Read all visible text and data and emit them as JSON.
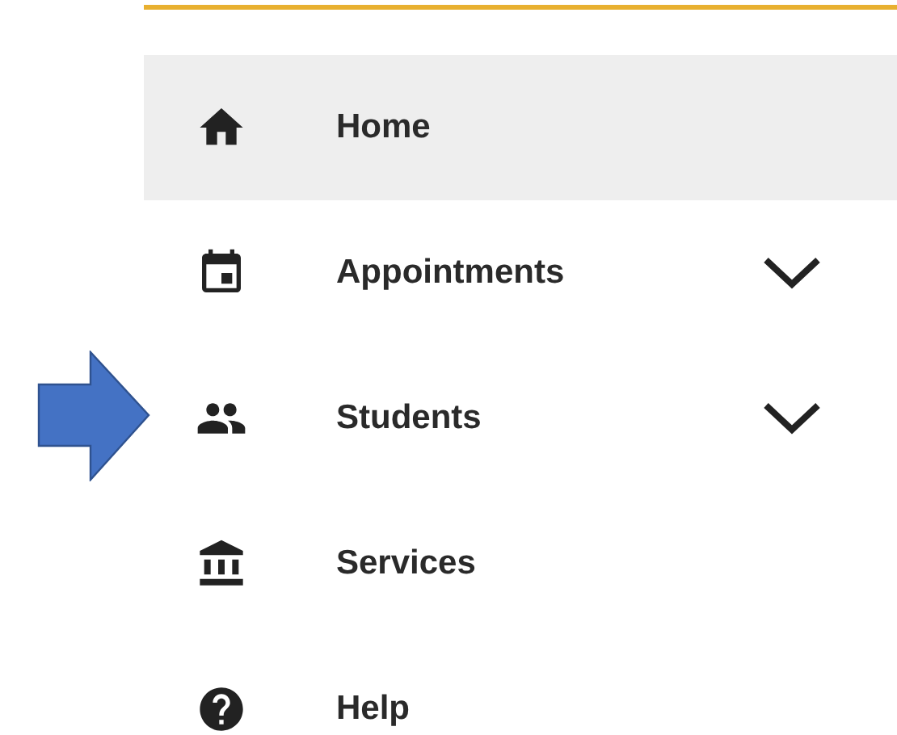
{
  "menu": {
    "items": [
      {
        "label": "Home",
        "selected": true,
        "expandable": false
      },
      {
        "label": "Appointments",
        "selected": false,
        "expandable": true
      },
      {
        "label": "Students",
        "selected": false,
        "expandable": true
      },
      {
        "label": "Services",
        "selected": false,
        "expandable": false
      },
      {
        "label": "Help",
        "selected": false,
        "expandable": false
      }
    ]
  }
}
